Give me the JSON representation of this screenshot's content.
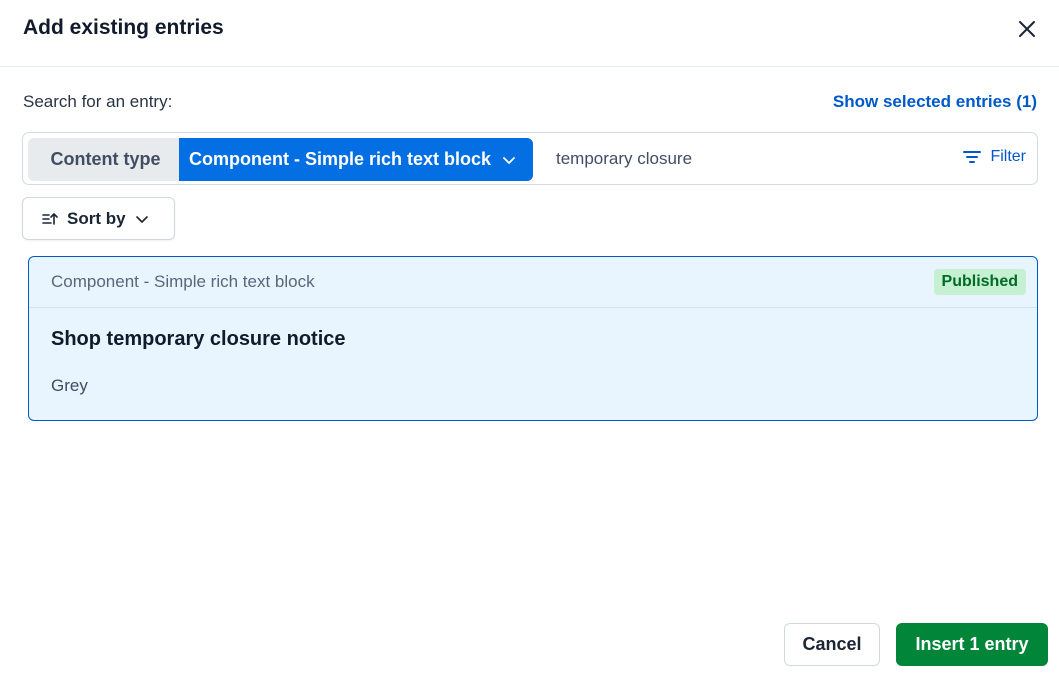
{
  "dialog": {
    "title": "Add existing entries"
  },
  "search": {
    "label": "Search for an entry:",
    "show_selected": "Show selected entries (1)",
    "filter_label": "Content type",
    "filter_value": "Component - Simple rich text block",
    "query": "temporary closure",
    "filter_button": "Filter"
  },
  "sort": {
    "label": "Sort by"
  },
  "entries": [
    {
      "content_type": "Component - Simple rich text block",
      "status": "Published",
      "title": "Shop temporary closure notice",
      "description": "Grey"
    }
  ],
  "footer": {
    "cancel_label": "Cancel",
    "insert_label": "Insert 1 entry"
  },
  "colors": {
    "primary_blue": "#036fe3",
    "link_blue": "#0059c8",
    "positive_green": "#008539",
    "badge_bg": "#c5f0d2",
    "selected_card_bg": "#e8f5ff"
  },
  "icons": [
    "close-icon",
    "chevron-down-icon",
    "filter-icon",
    "sort-icon"
  ]
}
